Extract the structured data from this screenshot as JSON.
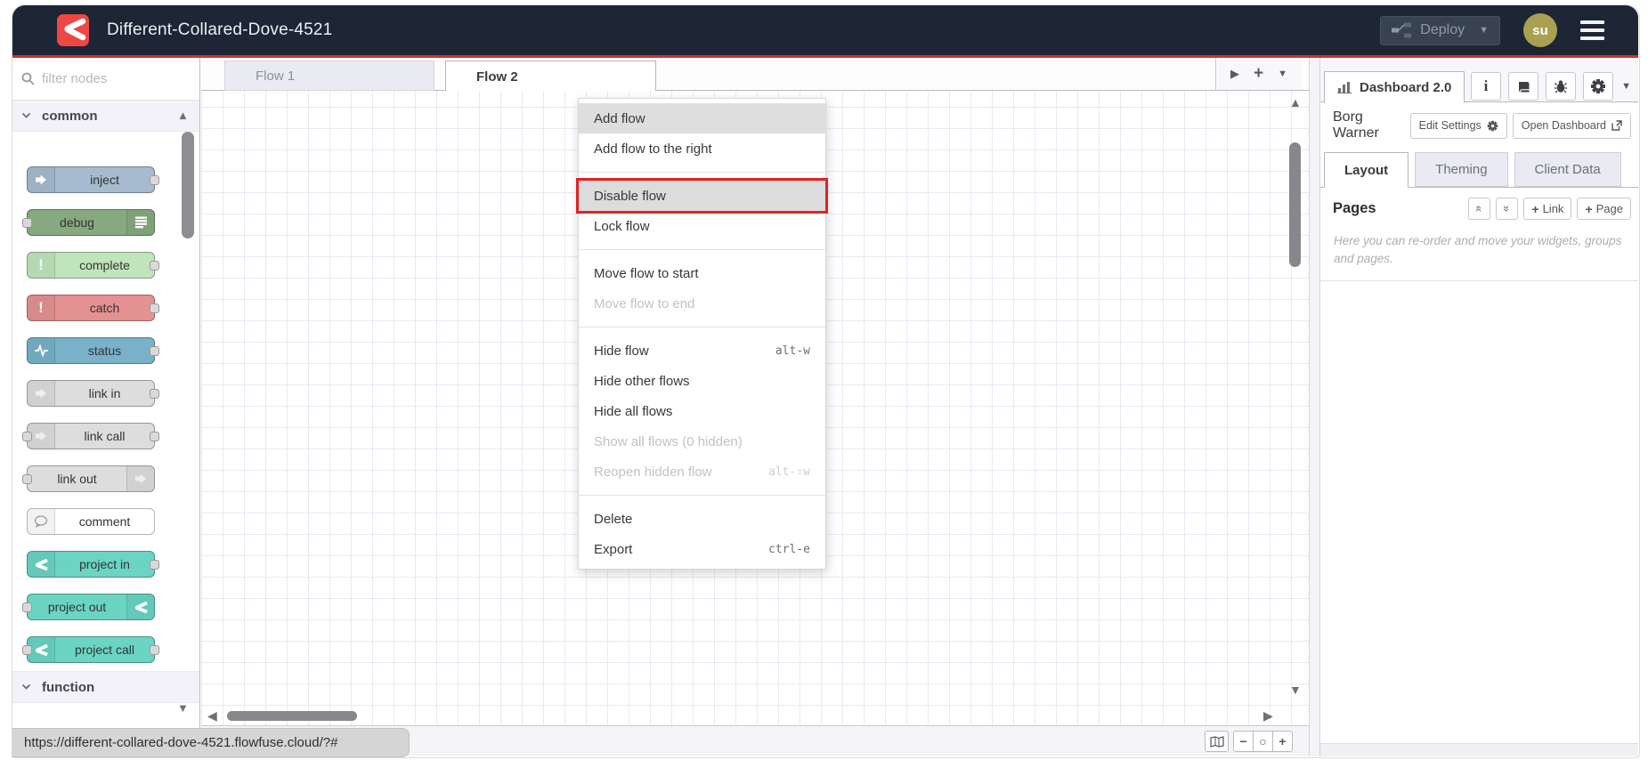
{
  "header": {
    "title": "Different-Collared-Dove-4521",
    "deploy_label": "Deploy",
    "avatar_initials": "su"
  },
  "palette": {
    "search_placeholder": "filter nodes",
    "categories": [
      {
        "label": "common"
      },
      {
        "label": "function"
      }
    ],
    "nodes": [
      {
        "label": "inject",
        "color": "#a6bbcf",
        "icon": "arrow-right-icon",
        "ports": "out"
      },
      {
        "label": "debug",
        "color": "#87a980",
        "icon": "list-lines-icon",
        "ports": "in"
      },
      {
        "label": "complete",
        "color": "#c0e5bc",
        "icon": "exclamation-icon",
        "ports": "out"
      },
      {
        "label": "catch",
        "color": "#e49191",
        "icon": "exclamation-icon",
        "ports": "out"
      },
      {
        "label": "status",
        "color": "#79b1c9",
        "icon": "pulse-icon",
        "ports": "out"
      },
      {
        "label": "link in",
        "color": "#dddddd",
        "icon": "link-arrow-icon",
        "ports": "out"
      },
      {
        "label": "link call",
        "color": "#dddddd",
        "icon": "link-arrow-icon",
        "ports": "both"
      },
      {
        "label": "link out",
        "color": "#dddddd",
        "icon": "link-arrow-icon",
        "ports": "in"
      },
      {
        "label": "comment",
        "color": "#ffffff",
        "icon": "speech-bubble-icon",
        "ports": "none"
      },
      {
        "label": "project in",
        "color": "#6bd4c3",
        "icon": "project-logo-icon",
        "ports": "out"
      },
      {
        "label": "project out",
        "color": "#6bd4c3",
        "icon": "project-logo-icon",
        "ports": "in"
      },
      {
        "label": "project call",
        "color": "#6bd4c3",
        "icon": "project-logo-icon",
        "ports": "both"
      }
    ]
  },
  "workspace": {
    "tabs": [
      {
        "label": "Flow 1",
        "active": false
      },
      {
        "label": "Flow 2",
        "active": true
      }
    ]
  },
  "context_menu": {
    "items": [
      {
        "label": "Add flow"
      },
      {
        "label": "Add flow to the right"
      },
      {
        "label": "Disable flow",
        "highlighted": true
      },
      {
        "label": "Lock flow"
      },
      {
        "label": "Move flow to start"
      },
      {
        "label": "Move flow to end",
        "disabled": true
      },
      {
        "label": "Hide flow",
        "shortcut": "alt-w"
      },
      {
        "label": "Hide other flows"
      },
      {
        "label": "Hide all flows"
      },
      {
        "label": "Show all flows (0 hidden)",
        "disabled": true
      },
      {
        "label": "Reopen hidden flow",
        "shortcut": "alt-⇧w",
        "disabled": true
      },
      {
        "label": "Delete"
      },
      {
        "label": "Export",
        "shortcut": "ctrl-e"
      }
    ]
  },
  "sidebar": {
    "tab_label": "Dashboard 2.0",
    "dashboard_name": "Borg Warner",
    "edit_settings_label": "Edit Settings",
    "open_dashboard_label": "Open Dashboard",
    "tabs": [
      {
        "label": "Layout",
        "active": true
      },
      {
        "label": "Theming",
        "active": false
      },
      {
        "label": "Client Data",
        "active": false
      }
    ],
    "pages_title": "Pages",
    "add_link_label": "Link",
    "add_page_label": "Page",
    "helper_text": "Here you can re-order and move your widgets, groups and pages."
  },
  "statusbar": {
    "url": "https://different-collared-dove-4521.flowfuse.cloud/?#"
  },
  "icons": {
    "logo": "flowfuse-logo",
    "search": "magnifier",
    "deploy": "node-graph",
    "sidebar_buttons": [
      "info-icon",
      "book-icon",
      "bug-icon",
      "gear-icon"
    ],
    "footer_buttons": [
      "map-icon",
      "zoom-out-icon",
      "zoom-reset-icon",
      "zoom-in-icon"
    ]
  },
  "colors": {
    "header_bg": "#1c2634",
    "accent_red": "#d22f2f",
    "highlight_red": "#de2322",
    "tab_inactive_bg": "#eaeaf3",
    "grid_line": "#e9e9f5",
    "avatar_bg": "#a9a050"
  }
}
